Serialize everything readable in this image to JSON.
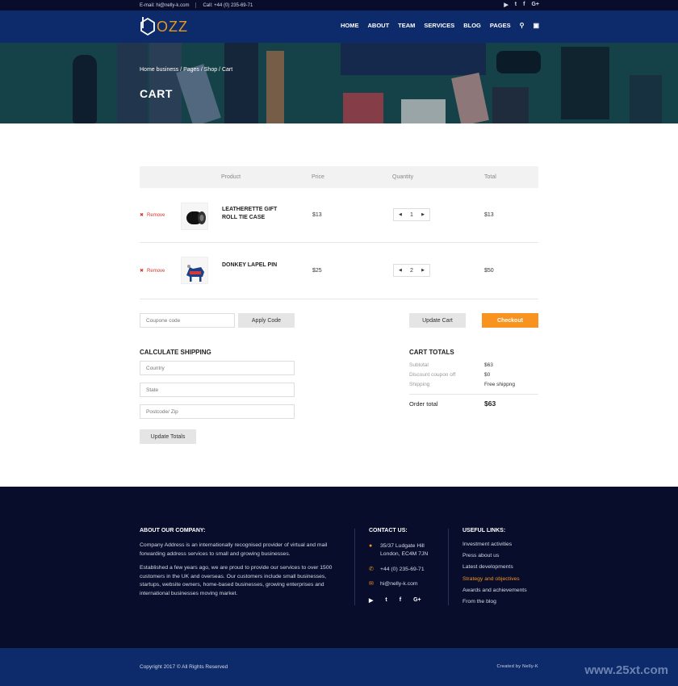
{
  "topbar": {
    "email": "E-mail:  hi@nelly-k.com",
    "phone": "Call:  +44 (0) 235-69-71",
    "social": [
      "▶",
      "t",
      "f",
      "G+"
    ]
  },
  "header": {
    "logo_text": "OZZ",
    "nav": [
      "HOME",
      "ABOUT",
      "TEAM",
      "SERVICES",
      "BLOG",
      "PAGES"
    ],
    "search_icon": "⚲",
    "cart_icon": "▣"
  },
  "hero": {
    "breadcrumb": "Home business / Pages / Shop / Cart",
    "title": "CART"
  },
  "cart": {
    "headers": {
      "product": "Product",
      "price": "Price",
      "quantity": "Quantity",
      "total": "Total"
    },
    "items": [
      {
        "remove": "Remove",
        "name": "LEATHERETTE GIFT ROLL TIE CASE",
        "price": "$13",
        "qty": "1",
        "total": "$13"
      },
      {
        "remove": "Remove",
        "name": "DONKEY LAPEL PIN",
        "price": "$25",
        "qty": "2",
        "total": "$50"
      }
    ],
    "coupon_placeholder": "Coupone code",
    "apply_label": "Apply Code",
    "update_label": "Update Cart",
    "checkout_label": "Checkout"
  },
  "shipping": {
    "title": "CALCULATE SHIPPING",
    "country_placeholder": "Country",
    "state_placeholder": "State",
    "zip_placeholder": "Postcode/ Zip",
    "update_label": "Update Totals"
  },
  "totals": {
    "title": "CART TOTALS",
    "subtotal_label": "Subtotal",
    "subtotal_value": "$63",
    "discount_label": "Discount coupon off",
    "discount_value": "$0",
    "shipping_label": "Shipping",
    "shipping_value": "Free shippng",
    "order_label": "Order total",
    "order_value": "$63"
  },
  "footer": {
    "about_title": "ABOUT OUR COMPANY:",
    "about_p1": "Company Address is an internationally recognised provider of virtual and mail forwarding address services to small and growing businesses.",
    "about_p2": "Established a few years ago, we are proud to provide our services to over 1500 customers in the UK and overseas. Our customers include small businesses, startups, website owners, home-based businesses, growing enterprises and international businesses moving market.",
    "contact_title": "CONTACT US:",
    "address": "35/37 Ludgate Hill London, EC4M 7JN",
    "phone": "+44 (0) 235-69-71",
    "email": "hi@nelly-k.com",
    "social": [
      "▶",
      "t",
      "f",
      "G+"
    ],
    "links_title": "USEFUL LINKS:",
    "links": [
      "Investment activities",
      "Press about us",
      "Latest developments",
      "Strategy and objectives",
      "Awards and achievements",
      "From the blog"
    ],
    "copyright": "Copyright 2017  ©  All Rights Reserved",
    "credit": "Created by Nelly-K"
  },
  "watermark": "www.25xt.com",
  "colors": {
    "accent": "#f7931e",
    "navy": "#0d2a6b",
    "dark": "#070d2a",
    "remove": "#d0382f"
  }
}
